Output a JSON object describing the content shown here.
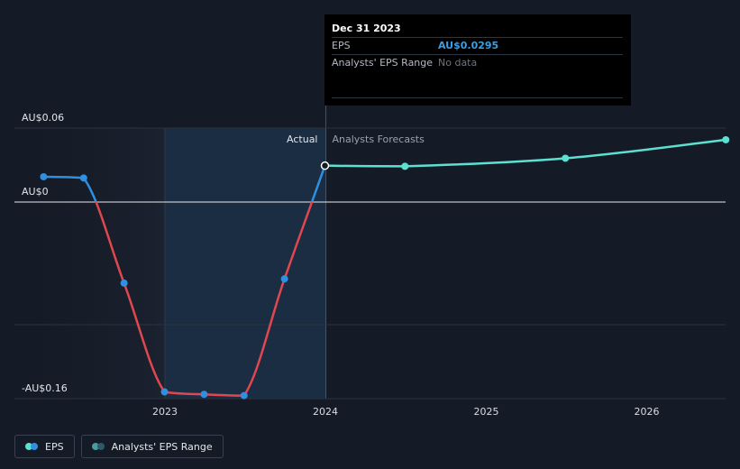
{
  "chart_data": {
    "type": "line",
    "currency": "AU$",
    "y_tick_labels": [
      "AU$0.06",
      "AU$0",
      "-AU$0.16"
    ],
    "ylim": [
      -0.16,
      0.06
    ],
    "x_tick_labels": [
      "2023",
      "2024",
      "2025",
      "2026"
    ],
    "xlim": [
      "2022-03-01",
      "2026-06-30"
    ],
    "divider_labels": {
      "actual": "Actual",
      "forecast": "Analysts Forecasts"
    },
    "series": [
      {
        "name": "EPS",
        "kind": "actual",
        "colors": {
          "positive": "#2f8fe0",
          "negative": "#e0474f"
        },
        "points": [
          {
            "x": "2022-03-31",
            "y": 0.0205
          },
          {
            "x": "2022-06-30",
            "y": 0.0195
          },
          {
            "x": "2022-09-30",
            "y": -0.066
          },
          {
            "x": "2022-12-31",
            "y": -0.1545
          },
          {
            "x": "2023-03-31",
            "y": -0.1565
          },
          {
            "x": "2023-06-30",
            "y": -0.1575
          },
          {
            "x": "2023-09-30",
            "y": -0.0625
          },
          {
            "x": "2023-12-31",
            "y": 0.0295
          }
        ]
      },
      {
        "name": "Analysts Forecasts",
        "kind": "forecast",
        "color": "#5ce0d2",
        "points": [
          {
            "x": "2023-12-31",
            "y": 0.0295
          },
          {
            "x": "2024-06-30",
            "y": 0.029
          },
          {
            "x": "2025-06-30",
            "y": 0.0355
          },
          {
            "x": "2026-06-30",
            "y": 0.0505
          }
        ]
      }
    ],
    "highlight_period": [
      "2023-01-01",
      "2023-12-31"
    ],
    "grid": true,
    "legend_placement": "bottom-left"
  },
  "tooltip": {
    "date": "Dec 31 2023",
    "eps_label": "EPS",
    "eps_value": "AU$0.0295",
    "range_label": "Analysts' EPS Range",
    "range_value": "No data"
  },
  "legend": {
    "eps_label": "EPS",
    "range_label": "Analysts' EPS Range"
  },
  "colors": {
    "background": "#151b26",
    "eps": "#2f8fe0",
    "eps_negative": "#e0474f",
    "forecast": "#5ce0d2",
    "range_dot_left": "#4b9aa3",
    "range_dot_right": "#2c5a66"
  }
}
